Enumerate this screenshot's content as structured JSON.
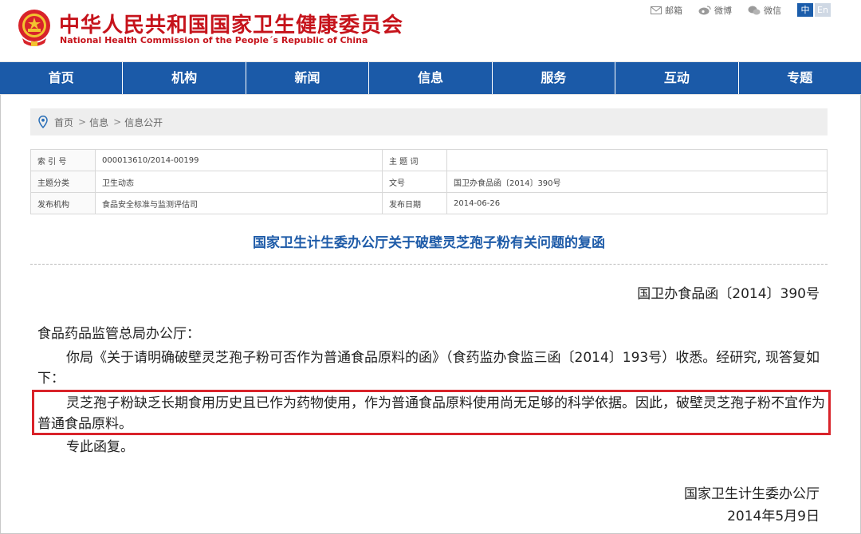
{
  "header": {
    "title_cn": "中华人民共和国国家卫生健康委员会",
    "title_en": "National Health Commission of the People´s Republic of China",
    "links": [
      {
        "label": "邮箱",
        "icon": "mail-icon"
      },
      {
        "label": "微博",
        "icon": "weibo-icon"
      },
      {
        "label": "微信",
        "icon": "wechat-icon"
      }
    ],
    "lang_cn": "中",
    "lang_en": "En"
  },
  "nav": {
    "items": [
      "首页",
      "机构",
      "新闻",
      "信息",
      "服务",
      "互动",
      "专题"
    ]
  },
  "breadcrumb": {
    "items": [
      "首页",
      "信息",
      "信息公开"
    ],
    "separator": ">"
  },
  "meta": {
    "index_label": "索 引 号",
    "index_value": "000013610/2014-00199",
    "keyword_label": "主 题 词",
    "keyword_value": "",
    "category_label": "主题分类",
    "category_value": "卫生动态",
    "docno_label": "文号",
    "docno_value": "国卫办食品函〔2014〕390号",
    "org_label": "发布机构",
    "org_value": "食品安全标准与监测评估司",
    "date_label": "发布日期",
    "date_value": "2014-06-26"
  },
  "article": {
    "title": "国家卫生计生委办公厅关于破壁灵芝孢子粉有关问题的复函",
    "doc_no": "国卫办食品函〔2014〕390号",
    "addressee": "食品药品监管总局办公厅：",
    "para1": "你局《关于请明确破壁灵芝孢子粉可否作为普通食品原料的函》（食药监办食监三函〔2014〕193号）收悉。经研究, 现答复如下：",
    "para2": "灵芝孢子粉缺乏长期食用历史且已作为药物使用，作为普通食品原料使用尚无足够的科学依据。因此，破壁灵芝孢子粉不宜作为普通食品原料。",
    "para3": "专此函复。",
    "signer": "国家卫生计生委办公厅",
    "sign_date": "2014年5月9日"
  },
  "colors": {
    "brand_red": "#c6131b",
    "nav_blue": "#1b5aa8",
    "highlight_red": "#d9232a"
  }
}
